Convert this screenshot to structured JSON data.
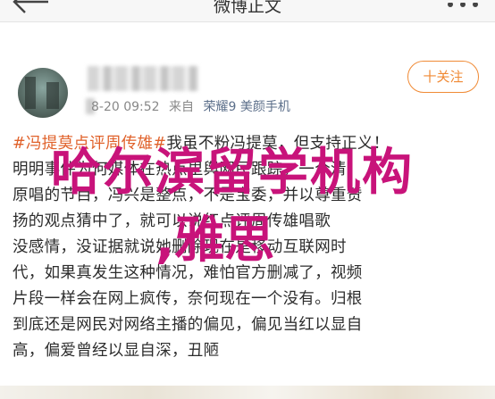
{
  "header": {
    "title": "微博正文",
    "back_icon": "back-arrow-icon",
    "more_icon": "more-icon"
  },
  "post": {
    "meta": {
      "time": "8-20 09:52",
      "source_prefix": "来自",
      "source": "荣耀9 美颜手机"
    },
    "follow_label": "十关注",
    "body_lines": [
      {
        "topic": "#冯提莫点评周传雄#",
        "text": "我虽不粉冯提莫，但支持正义！"
      },
      {
        "topic": "",
        "text": "明明事件为何媒体在热点里舆网民跟踪，一个清"
      },
      {
        "topic": "",
        "text": "原唱的节目，冯兴是整点，不是宝委，并以尊重赞"
      },
      {
        "topic": "",
        "text": "扬的观点猜中了，就可以说红点评周传雄唱歌"
      },
      {
        "topic": "",
        "text": "没感情，没证据就说她删除现在是移动互联网时"
      },
      {
        "topic": "",
        "text": "代，如果真发生这种情况，难怕官方删减了，视频"
      },
      {
        "topic": "",
        "text": "片段一样会在网上疯传，奈何现在一个没有。归根"
      },
      {
        "topic": "",
        "text": "到底还是网民对网络主播的偏见，偏见当红以显自"
      },
      {
        "topic": "",
        "text": "高，偏爱曾经以显自深，丑陋"
      }
    ]
  },
  "watermark": {
    "line1": "哈尔滨留学机构",
    "line2": ",雅思"
  },
  "colors": {
    "accent": "#f08a35",
    "topic": "#e0612a",
    "watermark": "#c8137a"
  }
}
